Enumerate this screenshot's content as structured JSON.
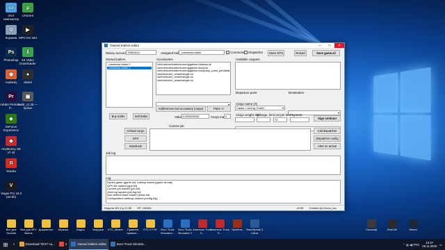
{
  "desktop_left_icons": [
    {
      "label": "Этот компьютер",
      "icon": "computer-icon",
      "color": "#4aa3df",
      "glyph": "▭"
    },
    {
      "label": "Корзина",
      "icon": "recycle-bin-icon",
      "color": "#8aa0b8",
      "glyph": "♲"
    },
    {
      "label": "Photoshop",
      "icon": "photoshop-icon",
      "color": "#0b2d4d",
      "glyph": "Ps"
    },
    {
      "label": "Audacity",
      "icon": "audacity-icon",
      "color": "#e0622f",
      "glyph": "◉"
    },
    {
      "label": "Adobe Premiere P...",
      "icon": "premiere-icon",
      "color": "#2a0c3e",
      "glyph": "Pr"
    },
    {
      "label": "GeForce Experience",
      "icon": "geforce-icon",
      "color": "#2f7a10",
      "glyph": "◈"
    },
    {
      "label": "AnyMoney SE v7.43",
      "icon": "anymoney-icon",
      "color": "#c72c2c",
      "glyph": "◆"
    },
    {
      "label": "Yandex",
      "icon": "yandex-icon",
      "color": "#d52b1e",
      "glyph": "Я"
    },
    {
      "label": "Vegas Pro 15.0 (64-bit)",
      "icon": "vegas-icon",
      "color": "#1b1b1b",
      "glyph": "V"
    }
  ],
  "desktop_second_column": [
    {
      "label": "uTorrent",
      "icon": "utorrent-icon",
      "color": "#3ba13b",
      "glyph": "µ"
    },
    {
      "label": "MPC-HC x64",
      "icon": "mpc-icon",
      "color": "#222",
      "glyph": "▶"
    },
    {
      "label": "4K Video Downloader",
      "icon": "video-downloader-icon",
      "color": "#37a34a",
      "glyph": "⇩"
    },
    {
      "label": "obs64",
      "icon": "obs-icon",
      "color": "#302e31",
      "glyph": "●"
    },
    {
      "label": "build_v1.35 — ярлык",
      "icon": "shortcut-icon",
      "color": "#5a5a5a",
      "glyph": "▣"
    }
  ],
  "window": {
    "title": "Owned trailers editor",
    "money_label": "Money account",
    "money_value": "70661619",
    "assigned_label": "Assigned trailer",
    "assigned_value": "_nameless.trailer",
    "connected_label": "Connected",
    "dispatcher_label": "Dispatcher",
    "store_gps": "Store GPS",
    "reload": "Reload",
    "save_game": "Save game.sii",
    "owned_trailers_label": "Owned trailers",
    "owned_trailers": [
      "_nameless.trailer.0",
      "_nameless.trailer.1"
    ],
    "accessories_label": "Accessories",
    "accessories": [
      "/def/vehicle/trailer/krone/gigaliner/chassis.sii",
      "/def/vehicle/trailer/krone/gigaliner/body.sii",
      "/def/vehicle/trailer/krone/gigaliner/company_paint_job/default.sii",
      "/def/vehicle/t_wheel/single.sii",
      "/def/vehicle/t_wheel/single.sii",
      "/def/vehicle/t_wheel/single.sii"
    ],
    "add_accessory": "Add/remove last accessory (cargo)",
    "paint_btn": "Paint +/-",
    "buy_trailer": "Buy trailer",
    "sell_trailer": "Sell trailer",
    "value_label": "Value",
    "value_value": "0.000000000",
    "cargo_mass_label": "Cargo mass",
    "cargo_mass_value": "0",
    "available_cargoes_label": "Available cargoes",
    "departure_label": "Departure point",
    "departure_value": "Calais: LiveLog GmbH",
    "destination_label": "Destination",
    "cargo_label": "Cargo name (S)",
    "cargo_weight_label": "Cargo weight, kg",
    "mileage_label": "Mileage, km",
    "cost_label": "Cost per km",
    "payment_label": "Payment",
    "cost_value": "75",
    "sign_contract": "Sign contract",
    "current_job_label": "Current job",
    "unload_cargo": "Unload cargo",
    "gps": "GPS",
    "notebook": "Notebook",
    "call_dispatcher": "Call dispatcher",
    "dispatcher_config": "Dispatcher config",
    "alert_on_arrival": "Alert on arrival",
    "job_log_label": "Job log",
    "log_label": "Log",
    "log_lines": [
      "Saved game (game.sii), backup saved (game.sii.bak)",
      "GPS file loaded (gps.txt)",
      "Current job loaded (job.txt)",
      "Jobs log loaded (job.log.txt)",
      "Non-default base loaded (base.txt)",
      "Configuration settings loaded (config.cfg)"
    ],
    "status_left": "Неделя 322,Ср 21:55",
    "status_mid": "XP: 150651",
    "status_version": "v3.05",
    "status_created": "Created by Kroon_xxx"
  },
  "bottom_row_icons": [
    {
      "label": "Все для Youtube",
      "color": "#f0c040"
    },
    {
      "label": "Все для ВТХ Beans",
      "color": "#f0c040"
    },
    {
      "label": "Документы",
      "color": "#f0c040"
    },
    {
      "label": "Музыка",
      "color": "#f0c040"
    },
    {
      "label": "Видео",
      "color": "#f0c040"
    },
    {
      "label": "Загрузки",
      "color": "#f0c040"
    },
    {
      "label": "ETC_Beans",
      "color": "#f0c040"
    },
    {
      "label": "Правила превью...",
      "color": "#f0c040"
    },
    {
      "label": "ETC KTYE",
      "color": "#f0c040"
    },
    {
      "label": "Euro Truck Simulator...",
      "color": "#2a6fc0"
    },
    {
      "label": "Euro Truck Simulator 2",
      "color": "#2a6fc0"
    },
    {
      "label": "American Truck S...",
      "color": "#c02a2a"
    },
    {
      "label": "American Truck S...",
      "color": "#c02a2a"
    },
    {
      "label": "Spintires",
      "color": "#9a2f14"
    },
    {
      "label": "TeamSpeak 3 Client",
      "color": "#2b5c96"
    },
    {
      "label": "Очкокоф",
      "color": "#3a3a3a"
    },
    {
      "label": "RedCell",
      "color": "#2a2a2a"
    },
    {
      "label": "Steam",
      "color": "#1b2838"
    }
  ],
  "taskbar": {
    "items": [
      {
        "label": "Download TEXT ca...",
        "color": "#e8a33a",
        "active": false
      },
      {
        "label": "2",
        "color": "#e84a3a",
        "active": false
      },
      {
        "label": "Owned trailers editor",
        "color": "#2f6fbf",
        "active": true
      },
      {
        "label": "Euro Truck Simulat...",
        "color": "#3a6fb0",
        "active": false
      }
    ],
    "lang": "РУС",
    "time": "13:37",
    "date": "05.11.2018"
  },
  "accent_color": "#0078d7"
}
